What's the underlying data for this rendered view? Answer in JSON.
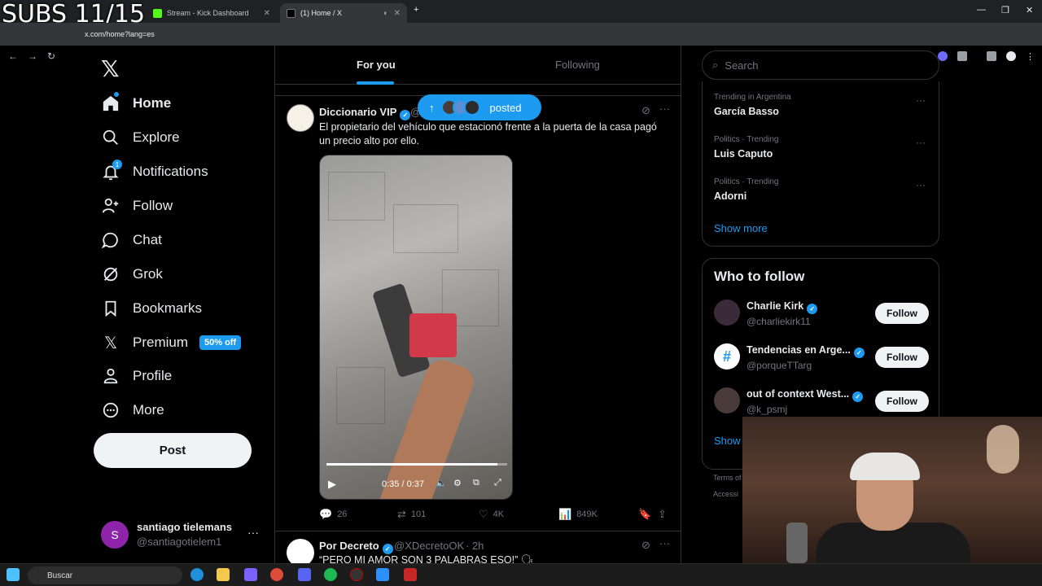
{
  "overlay": {
    "subs": "SUBS 11/15"
  },
  "browser": {
    "tabs": [
      {
        "label": "Stream - Kick Dashboard",
        "active": false
      },
      {
        "label": "(1) Home / X",
        "active": true
      }
    ],
    "url": "x.com/home?lang=es"
  },
  "nav": {
    "items": [
      {
        "label": "Home",
        "icon": "home-icon"
      },
      {
        "label": "Explore",
        "icon": "search-icon"
      },
      {
        "label": "Notifications",
        "icon": "bell-icon"
      },
      {
        "label": "Follow",
        "icon": "person-add-icon"
      },
      {
        "label": "Chat",
        "icon": "chat-icon"
      },
      {
        "label": "Grok",
        "icon": "grok-icon"
      },
      {
        "label": "Bookmarks",
        "icon": "bookmark-icon"
      },
      {
        "label": "Premium",
        "icon": "x-icon"
      },
      {
        "label": "Profile",
        "icon": "person-icon"
      },
      {
        "label": "More",
        "icon": "more-circle-icon"
      }
    ],
    "notif_count": "1",
    "premium_badge": "50% off",
    "post_label": "Post",
    "account": {
      "initial": "S",
      "name": "santiago tielemans",
      "handle": "@santiagotielem1",
      "more": "···"
    }
  },
  "feed": {
    "tab_for_you": "For you",
    "tab_following": "Following",
    "posted_pill": "posted",
    "tweet1": {
      "name": "Diccionario VIP",
      "handle": "@",
      "text": "El propietario del vehículo que estacionó frente a la puerta de la casa pagó un precio alto por ello.",
      "video_time": "0:35 / 0:37",
      "video_progress": 0.946,
      "replies": "26",
      "reposts": "101",
      "likes": "4K",
      "views": "849K"
    },
    "tweet2": {
      "name": "Por Decreto",
      "handle": "@XDecretoOK",
      "time": "· 2h",
      "text": "“PERO MI AMOR SON 3 PALABRAS ESO!” 🗣"
    }
  },
  "right": {
    "search_placeholder": "Search",
    "trends": [
      {
        "meta": "Trending in Argentina",
        "name": "García Basso"
      },
      {
        "meta": "Politics · Trending",
        "name": "Luis Caputo"
      },
      {
        "meta": "Politics · Trending",
        "name": "Adorni"
      }
    ],
    "show_more": "Show more",
    "who_to_follow_title": "Who to follow",
    "suggestions": [
      {
        "name": "Charlie Kirk",
        "handle": "@charliekirk11",
        "button": "Follow"
      },
      {
        "name": "Tendencias en Arge...",
        "handle": "@porqueTTarg",
        "button": "Follow"
      },
      {
        "name": "out of context West...",
        "handle": "@k_psmj",
        "button": "Follow"
      }
    ],
    "show_more_2": "Show",
    "footer_terms": "Terms of",
    "footer_access": "Accessi"
  },
  "taskbar": {
    "search": "Buscar"
  }
}
